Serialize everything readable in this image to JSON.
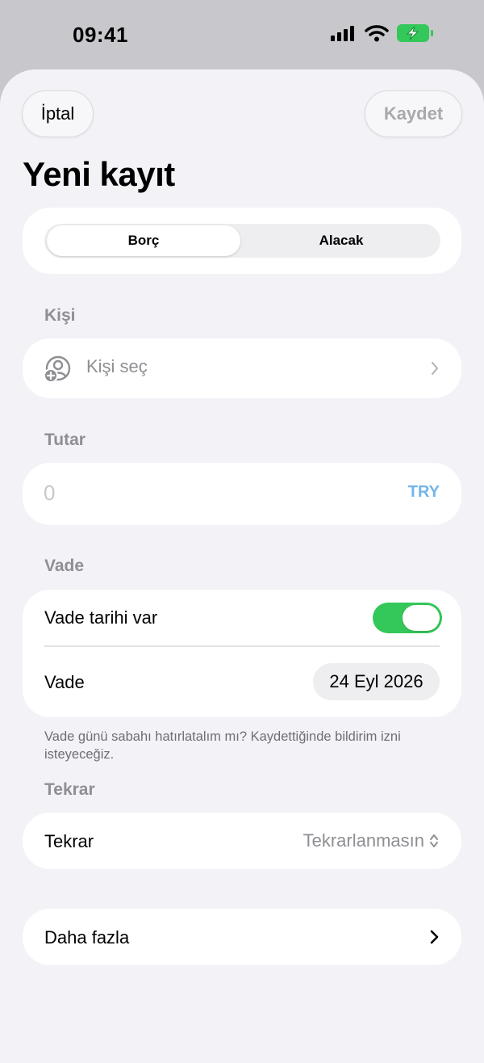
{
  "status": {
    "time": "09:41"
  },
  "header": {
    "cancel_label": "İptal",
    "save_label": "Kaydet",
    "title": "Yeni kayıt"
  },
  "segment": {
    "options": [
      "Borç",
      "Alacak"
    ],
    "selected": "Borç"
  },
  "person": {
    "section_label": "Kişi",
    "placeholder": "Kişi seç"
  },
  "amount": {
    "section_label": "Tutar",
    "value": "0",
    "currency": "TRY"
  },
  "due": {
    "section_label": "Vade",
    "toggle_label": "Vade tarihi var",
    "toggle_on": true,
    "date_label": "Vade",
    "date_value": "24 Eyl 2026",
    "footnote": "Vade günü sabahı hatırlatalım mı? Kaydettiğinde bildirim izni isteyeceğiz."
  },
  "repeat": {
    "section_label": "Tekrar",
    "row_label": "Tekrar",
    "value": "Tekrarlanmasın"
  },
  "more": {
    "label": "Daha fazla"
  },
  "colors": {
    "accent_green": "#34c759",
    "currency_blue": "#74b5e8",
    "background": "#f2f2f7",
    "secondary_text": "#8e8e93"
  }
}
